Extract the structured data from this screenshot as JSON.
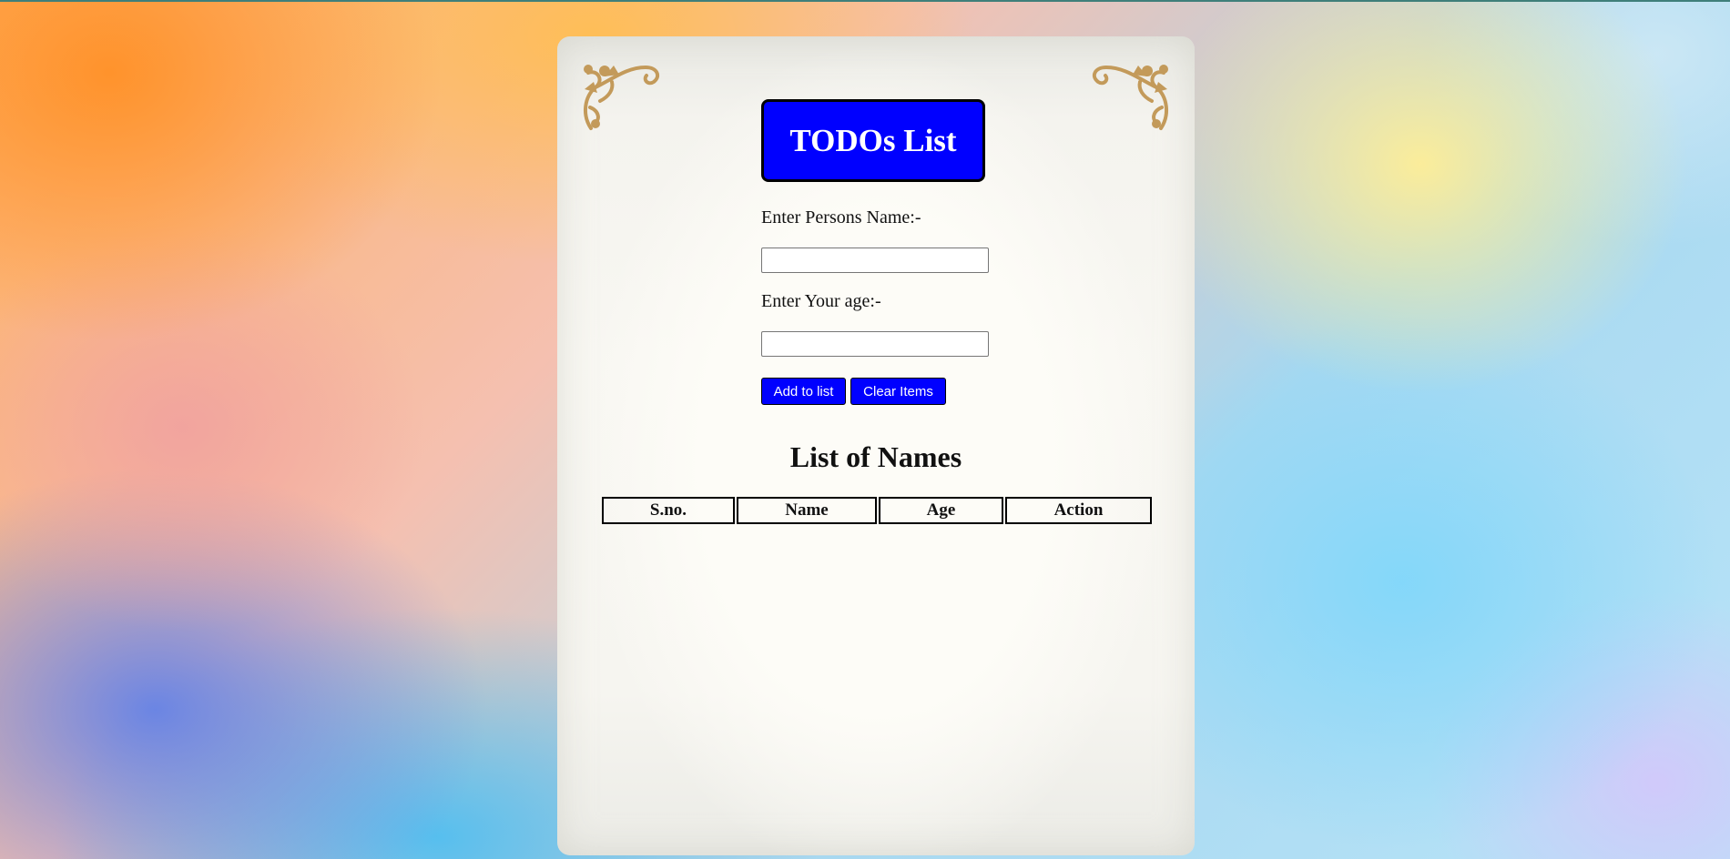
{
  "page": {
    "title": "TODOs List"
  },
  "form": {
    "name_label": "Enter Persons Name:-",
    "name_value": "",
    "age_label": "Enter Your age:-",
    "age_value": "",
    "add_button": "Add to list",
    "clear_button": "Clear Items"
  },
  "list": {
    "heading": "List of Names",
    "columns": [
      "S.no.",
      "Name",
      "Age",
      "Action"
    ],
    "rows": []
  },
  "icons": {
    "corner_ornament": "floral-corner-ornament-icon"
  },
  "colors": {
    "accent": "#0000ff",
    "ornament": "#c39a5a",
    "paper": "#f8f7f2"
  }
}
